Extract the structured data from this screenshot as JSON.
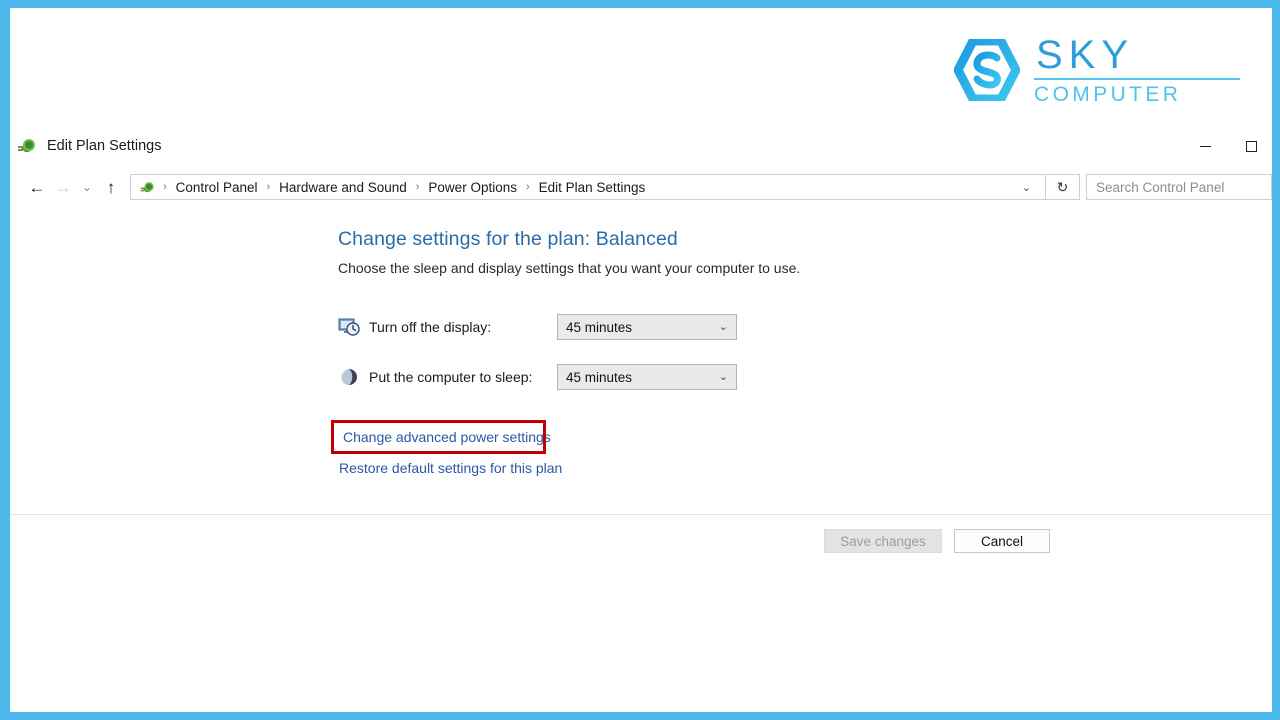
{
  "brand": {
    "name_primary": "SKY",
    "name_secondary": "COMPUTER",
    "mark_icon": "hexagon-s-logo-icon",
    "color_primary": "#2e9ddb",
    "color_secondary": "#4fc3ec"
  },
  "frame": {
    "border_color": "#4cb8ec"
  },
  "window": {
    "title": "Edit Plan Settings",
    "title_icon": "power-plug-icon",
    "controls": {
      "minimize": "–",
      "maximize": "□"
    }
  },
  "nav": {
    "back_icon": "arrow-left-icon",
    "forward_icon": "arrow-right-icon",
    "recent_icon": "chevron-down-icon",
    "up_icon": "arrow-up-icon",
    "address_icon": "power-plug-icon",
    "breadcrumbs": [
      "Control Panel",
      "Hardware and Sound",
      "Power Options",
      "Edit Plan Settings"
    ],
    "separator": "›",
    "address_dropdown_icon": "chevron-down-icon",
    "refresh_icon": "refresh-icon",
    "refresh_glyph": "↻"
  },
  "search": {
    "placeholder": "Search Control Panel",
    "value": ""
  },
  "main": {
    "title": "Change settings for the plan: Balanced",
    "subtitle": "Choose the sleep and display settings that you want your computer to use.",
    "settings": [
      {
        "icon": "display-clock-icon",
        "label": "Turn off the display:",
        "value": "45 minutes",
        "arrow": "⌄"
      },
      {
        "icon": "sleep-moon-icon",
        "label": "Put the computer to sleep:",
        "value": "45 minutes",
        "arrow": "⌄"
      }
    ],
    "links": [
      {
        "label": "Change advanced power settings",
        "highlighted": true
      },
      {
        "label": "Restore default settings for this plan",
        "highlighted": false
      }
    ],
    "annotation_color": "#c00000"
  },
  "footer": {
    "save_label": "Save changes",
    "save_disabled": true,
    "cancel_label": "Cancel"
  }
}
